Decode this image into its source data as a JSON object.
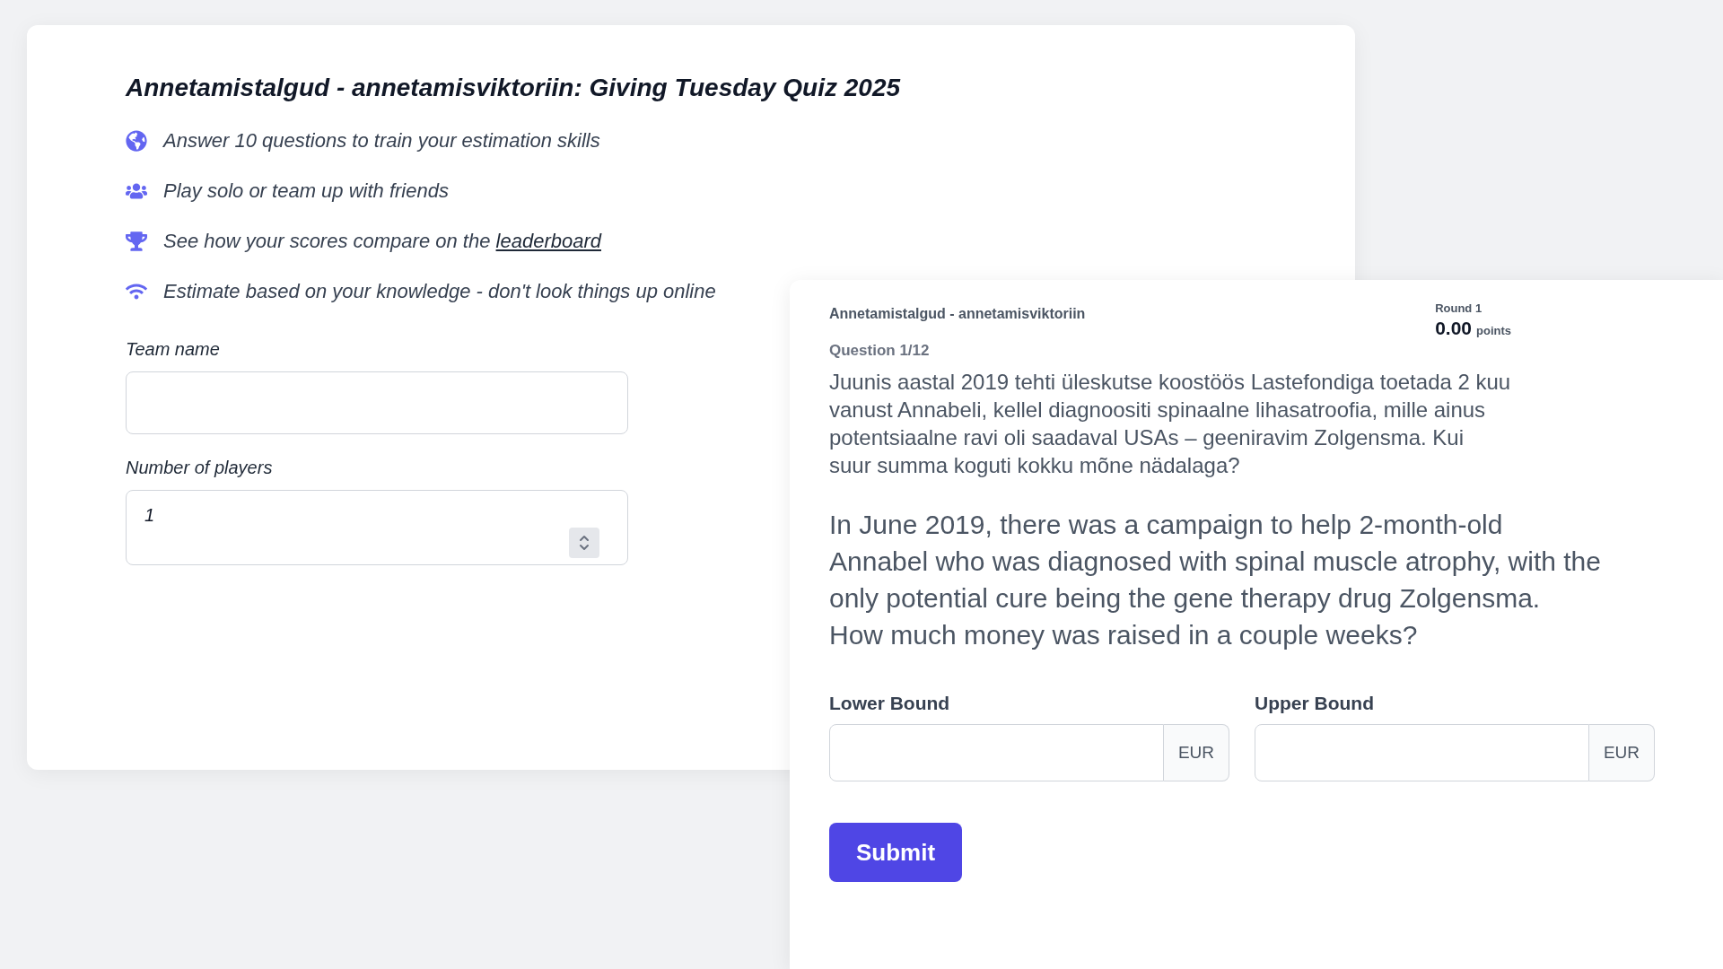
{
  "intro_card": {
    "title": "Annetamistalgud - annetamisviktoriin: Giving Tuesday Quiz 2025",
    "features": [
      {
        "text": "Answer 10 questions to train your estimation skills"
      },
      {
        "text": "Play solo or team up with friends"
      },
      {
        "text": "See how your scores compare on the",
        "link": "leaderboard"
      },
      {
        "text": "Estimate based on your knowledge - don't look things up online"
      }
    ],
    "team_name": {
      "label": "Team name"
    },
    "players": {
      "label": "Number of players",
      "value": "1"
    }
  },
  "question_card": {
    "quiz_name": "Annetamistalgud - annetamisviktoriin",
    "round": "Round 1",
    "score": "0.00",
    "score_unit": "points",
    "question_number": "Question 1/12",
    "text_et": "Juunis aastal 2019 tehti üleskutse koostöös Lastefondiga toetada 2 kuu vanust Annabeli, kellel diagnoositi spinaalne lihasatroofia, mille ainus potentsiaalne ravi oli saadaval USAs – geeniravim Zolgensma. Kui suur summa koguti kokku mõne nädalaga?",
    "text_en": "In June 2019, there was a campaign to help 2-month-old Annabel who was diagnosed with spinal muscle atrophy, with the only potential cure being the gene therapy drug Zolgensma. How much money was raised in a couple weeks?",
    "bounds": [
      {
        "label": "Lower Bound",
        "currency": "EUR"
      },
      {
        "label": "Upper Bound",
        "currency": "EUR"
      }
    ],
    "submit": "Submit"
  }
}
